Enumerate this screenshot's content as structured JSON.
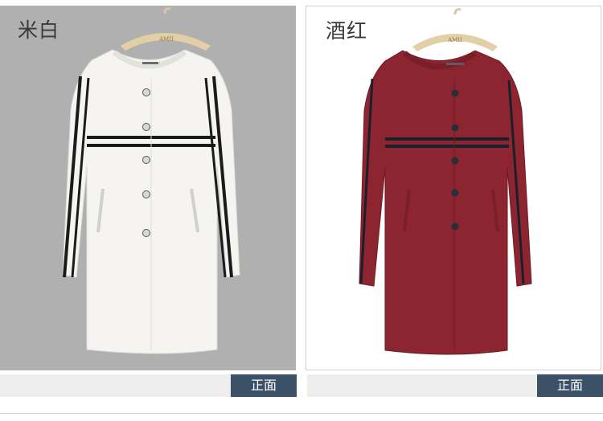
{
  "products": [
    {
      "color_name": "米白",
      "view_label": "正面",
      "hanger_brand": "AMII",
      "coat_color": "#f5f4f0",
      "stripe_color": "#1b1b1b",
      "background": "#b0b0b0"
    },
    {
      "color_name": "酒红",
      "view_label": "正面",
      "hanger_brand": "AMII",
      "coat_color": "#8c2530",
      "stripe_color": "#1b1f2b",
      "background": "#ffffff"
    }
  ]
}
